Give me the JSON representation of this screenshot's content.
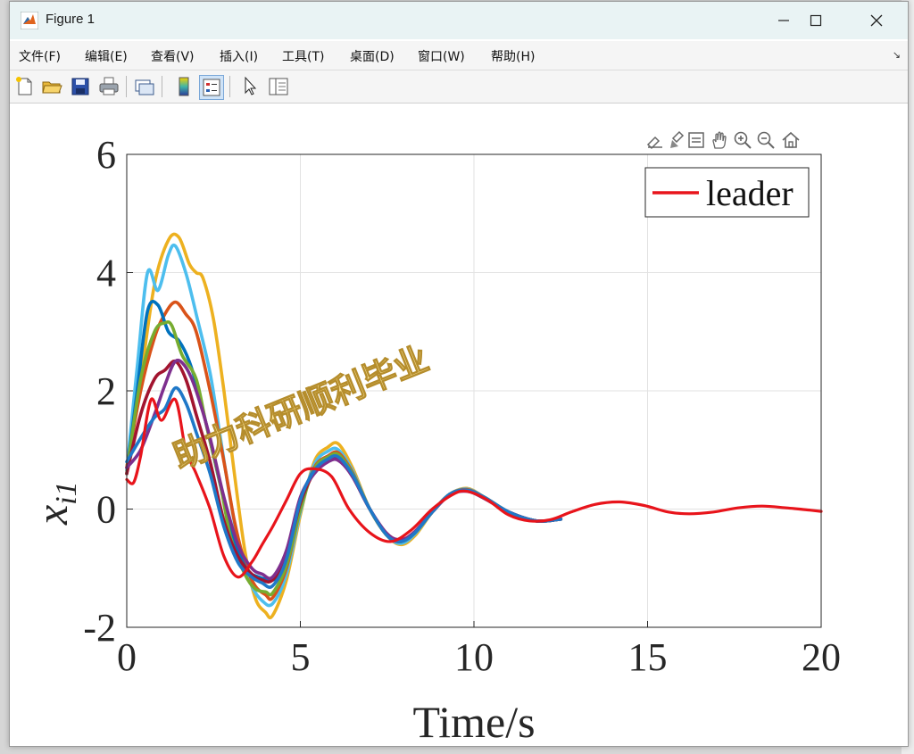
{
  "window": {
    "title": "Figure 1"
  },
  "menu": [
    "文件(F)",
    "编辑(E)",
    "查看(V)",
    "插入(I)",
    "工具(T)",
    "桌面(D)",
    "窗口(W)",
    "帮助(H)"
  ],
  "axes": {
    "ylabel_main": "x",
    "ylabel_sub": "i1",
    "xlabel": "Time/s",
    "xticks": [
      "0",
      "5",
      "10",
      "15",
      "20"
    ],
    "yticks": [
      "-2",
      "0",
      "2",
      "4",
      "6"
    ],
    "legend": "leader"
  },
  "watermark": "助力科研顺利毕业",
  "colors": {
    "leader": "#e8141b",
    "titlebar": "#e9f3f4"
  },
  "chart_data": {
    "type": "line",
    "xlabel": "Time/s",
    "ylabel": "x_i1",
    "xlim": [
      0,
      20
    ],
    "ylim": [
      -2,
      6
    ],
    "grid": true,
    "legend_position": "top-right",
    "series": [
      {
        "name": "leader",
        "color": "#e8141b",
        "x": [
          0,
          0.2,
          0.4,
          0.7,
          1.0,
          1.4,
          1.7,
          2.0,
          2.4,
          2.8,
          3.2,
          3.6,
          3.9,
          4.2,
          4.6,
          5.0,
          5.4,
          5.9,
          6.4,
          7.0,
          7.6,
          8.2,
          8.8,
          9.4,
          9.8,
          10.4,
          11.0,
          11.6,
          12.2,
          12.8,
          13.5,
          14.2,
          14.9,
          15.6,
          16.2,
          16.9,
          17.6,
          18.3,
          19.0,
          19.7,
          20
        ],
        "y": [
          0.5,
          0.45,
          0.9,
          1.85,
          1.5,
          1.85,
          1.0,
          0.6,
          0.0,
          -0.8,
          -1.15,
          -0.9,
          -0.6,
          -0.3,
          0.15,
          0.6,
          0.68,
          0.55,
          0.0,
          -0.4,
          -0.55,
          -0.35,
          0.0,
          0.25,
          0.3,
          0.15,
          -0.1,
          -0.2,
          -0.18,
          -0.05,
          0.08,
          0.12,
          0.06,
          -0.05,
          -0.08,
          -0.05,
          0.02,
          0.05,
          0.02,
          -0.02,
          -0.04
        ]
      },
      {
        "color": "#edb120",
        "x": [
          0,
          0.4,
          0.8,
          1.2,
          1.5,
          1.8,
          2.0,
          2.2,
          2.5,
          2.8,
          3.1,
          3.4,
          3.7,
          4.0,
          4.2,
          4.6,
          5.0,
          5.4,
          5.8,
          6.1,
          6.5,
          7.0,
          7.5,
          7.9,
          8.3,
          8.8,
          9.3,
          9.8,
          10.3,
          11.0,
          11.8,
          12.5
        ],
        "y": [
          0.7,
          2.2,
          3.8,
          4.55,
          4.6,
          4.15,
          4.0,
          3.9,
          3.2,
          2.0,
          0.6,
          -0.7,
          -1.5,
          -1.75,
          -1.8,
          -1.2,
          -0.1,
          0.8,
          1.05,
          1.1,
          0.7,
          0.0,
          -0.45,
          -0.6,
          -0.45,
          -0.05,
          0.25,
          0.35,
          0.2,
          -0.05,
          -0.2,
          -0.17
        ]
      },
      {
        "color": "#4dbeee",
        "x": [
          0,
          0.3,
          0.6,
          0.9,
          1.2,
          1.4,
          1.7,
          2.0,
          2.4,
          2.7,
          3.0,
          3.3,
          3.6,
          3.9,
          4.2,
          4.6,
          5.0,
          5.4,
          5.8,
          6.1,
          6.5,
          7.0,
          7.5,
          7.9,
          8.3,
          8.8,
          9.3,
          9.8,
          10.3,
          11.0,
          11.8,
          12.5
        ],
        "y": [
          0.65,
          2.4,
          4.0,
          3.7,
          4.3,
          4.45,
          4.0,
          3.3,
          2.3,
          1.2,
          0.1,
          -0.8,
          -1.3,
          -1.55,
          -1.6,
          -1.1,
          -0.05,
          0.75,
          0.98,
          1.0,
          0.65,
          0.0,
          -0.45,
          -0.58,
          -0.42,
          -0.05,
          0.25,
          0.34,
          0.2,
          -0.05,
          -0.2,
          -0.17
        ]
      },
      {
        "color": "#d95319",
        "x": [
          0,
          0.4,
          0.8,
          1.1,
          1.4,
          1.7,
          2.0,
          2.4,
          2.8,
          3.1,
          3.4,
          3.7,
          4.0,
          4.2,
          4.6,
          5.0,
          5.4,
          5.8,
          6.1,
          6.5,
          7.0,
          7.5,
          7.9,
          8.3,
          8.8,
          9.3,
          9.8,
          10.3,
          11.0,
          11.8,
          12.5
        ],
        "y": [
          0.7,
          2.0,
          2.9,
          3.3,
          3.5,
          3.3,
          3.0,
          2.0,
          0.8,
          -0.2,
          -0.9,
          -1.3,
          -1.45,
          -1.5,
          -1.0,
          0.0,
          0.7,
          0.9,
          0.95,
          0.62,
          0.0,
          -0.45,
          -0.55,
          -0.4,
          -0.05,
          0.25,
          0.33,
          0.2,
          -0.05,
          -0.2,
          -0.17
        ]
      },
      {
        "color": "#0072bd",
        "x": [
          0,
          0.3,
          0.6,
          0.9,
          1.2,
          1.5,
          1.8,
          2.1,
          2.5,
          2.9,
          3.2,
          3.5,
          3.8,
          4.1,
          4.3,
          4.6,
          5.0,
          5.4,
          5.8,
          6.1,
          6.5,
          7.0,
          7.5,
          7.9,
          8.3,
          8.8,
          9.3,
          9.8,
          10.3,
          11.0,
          11.8,
          12.5
        ],
        "y": [
          0.6,
          2.0,
          3.35,
          3.45,
          3.0,
          2.85,
          2.5,
          1.9,
          0.9,
          -0.1,
          -0.7,
          -1.05,
          -1.15,
          -1.2,
          -1.15,
          -0.75,
          0.1,
          0.68,
          0.88,
          0.9,
          0.6,
          0.0,
          -0.45,
          -0.55,
          -0.4,
          -0.05,
          0.25,
          0.32,
          0.2,
          -0.05,
          -0.2,
          -0.17
        ]
      },
      {
        "color": "#77ac30",
        "x": [
          0,
          0.4,
          0.8,
          1.1,
          1.3,
          1.6,
          2.0,
          2.3,
          2.7,
          3.0,
          3.4,
          3.7,
          4.0,
          4.2,
          4.6,
          5.0,
          5.4,
          5.8,
          6.1,
          6.5,
          7.0,
          7.5,
          7.9,
          8.3,
          8.8,
          9.3,
          9.8,
          10.3,
          11.0,
          11.8,
          12.5
        ],
        "y": [
          0.6,
          2.2,
          3.0,
          3.15,
          3.1,
          2.6,
          2.2,
          1.4,
          0.4,
          -0.5,
          -1.1,
          -1.35,
          -1.4,
          -1.42,
          -0.95,
          0.0,
          0.68,
          0.88,
          0.92,
          0.6,
          0.0,
          -0.45,
          -0.55,
          -0.4,
          -0.05,
          0.25,
          0.32,
          0.2,
          -0.05,
          -0.2,
          -0.17
        ]
      },
      {
        "color": "#a2142f",
        "x": [
          0,
          0.4,
          0.8,
          1.1,
          1.4,
          1.7,
          2.0,
          2.4,
          2.8,
          3.2,
          3.6,
          3.9,
          4.2,
          4.6,
          5.0,
          5.4,
          5.8,
          6.1,
          6.5,
          7.0,
          7.5,
          7.9,
          8.3,
          8.8,
          9.3,
          9.8,
          10.3,
          11.0,
          11.8,
          12.5
        ],
        "y": [
          0.6,
          1.6,
          2.2,
          2.35,
          2.5,
          2.2,
          1.6,
          0.8,
          -0.2,
          -0.8,
          -1.1,
          -1.2,
          -1.2,
          -0.8,
          0.1,
          0.62,
          0.82,
          0.85,
          0.55,
          0.0,
          -0.42,
          -0.52,
          -0.38,
          -0.05,
          0.24,
          0.31,
          0.18,
          -0.05,
          -0.2,
          -0.17
        ]
      },
      {
        "color": "#7e2f8e",
        "x": [
          0,
          0.4,
          0.8,
          1.1,
          1.4,
          1.7,
          2.0,
          2.4,
          2.8,
          3.2,
          3.6,
          3.9,
          4.2,
          4.6,
          5.0,
          5.4,
          5.8,
          6.1,
          6.5,
          7.0,
          7.5,
          7.9,
          8.3,
          8.8,
          9.3,
          9.8,
          10.3,
          11.0,
          11.8,
          12.5
        ],
        "y": [
          0.7,
          1.0,
          1.6,
          2.1,
          2.5,
          2.4,
          2.0,
          1.2,
          0.2,
          -0.6,
          -1.0,
          -1.1,
          -1.15,
          -0.7,
          0.2,
          0.6,
          0.8,
          0.82,
          0.55,
          0.0,
          -0.42,
          -0.52,
          -0.38,
          -0.05,
          0.24,
          0.3,
          0.18,
          -0.05,
          -0.2,
          -0.17
        ]
      },
      {
        "color": "#1f78c8",
        "x": [
          0,
          0.4,
          0.8,
          1.1,
          1.4,
          1.7,
          2.0,
          2.4,
          2.8,
          3.2,
          3.6,
          3.9,
          4.2,
          4.6,
          5.0,
          5.4,
          5.8,
          6.1,
          6.5,
          7.0,
          7.5,
          7.9,
          8.3,
          8.8,
          9.3,
          9.8,
          10.3,
          11.0,
          11.8,
          12.5
        ],
        "y": [
          0.8,
          1.2,
          1.55,
          1.7,
          2.05,
          1.8,
          1.3,
          0.6,
          -0.3,
          -0.9,
          -1.15,
          -1.25,
          -1.3,
          -0.85,
          0.15,
          0.65,
          0.85,
          0.88,
          0.58,
          0.0,
          -0.45,
          -0.55,
          -0.4,
          -0.05,
          0.25,
          0.32,
          0.2,
          -0.05,
          -0.2,
          -0.17
        ]
      }
    ]
  }
}
